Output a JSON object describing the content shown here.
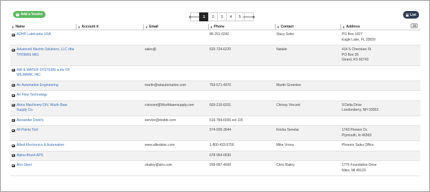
{
  "toolbar": {
    "add_vendor_label": "Add a Vendor",
    "list_label": "List",
    "pagination": {
      "prev": "🡐",
      "next": "🡒",
      "pages": [
        "1",
        "2",
        "3",
        "4",
        "5"
      ],
      "current": "1"
    }
  },
  "table": {
    "headers": {
      "name": "Name",
      "account": "Account #:",
      "email": "Email",
      "phone": "Phone",
      "contact": "Contact",
      "address": "Address"
    },
    "rows": [
      {
        "name": "ADHP Lubricants USA",
        "account": "",
        "email": "",
        "phone": "86-291-0240",
        "contact": "Stacy Soler",
        "address": [
          "PO Box 1427",
          "Eagle Lake, FL 33839"
        ]
      },
      {
        "name": "Advanced Machin Solutions, LLC dba THOMAS MIG",
        "account": "",
        "email": "sales@",
        "phone": "620-724-6220",
        "contact": "Natalie",
        "address": [
          "414 S Cherokee St",
          "PO Box 39",
          "Girard, KS 66743"
        ]
      },
      {
        "name": "AIR & WATER SYSTEMS a div OF WILMARK, INC",
        "account": "",
        "email": "",
        "phone": "",
        "contact": "",
        "address": []
      },
      {
        "name": "Air Automation Engineering",
        "account": "",
        "email": "martin@airautomation.com",
        "phone": "763-571-4970",
        "contact": "Martin Greenlee",
        "address": []
      },
      {
        "name": "Air Flow Technology",
        "account": "",
        "email": "",
        "phone": "",
        "contact": "",
        "address": []
      },
      {
        "name": "Akins Machinery DIV. Wurth Baer Supply Co.",
        "account": "",
        "email": "cvincent@Wurthbaersupply.com",
        "phone": "603-216-6201",
        "contact": "Chrissy Vincent",
        "address": [
          "9 Delta Drive",
          "Londonderry, NH 03053"
        ]
      },
      {
        "name": "Alexander Dodd's",
        "account": "",
        "email": "service@dodds.com",
        "phone": "616-784-6000 ext 115",
        "contact": "",
        "address": []
      },
      {
        "name": "All Points Tool",
        "account": "",
        "email": "",
        "phone": "574-935-3944",
        "contact": "Krisha Senetar",
        "address": [
          "1743 Pioneer Dr.",
          "Plymouth, In 46563"
        ]
      },
      {
        "name": "Allied Electronics & Automation",
        "account": "",
        "email": "www.alliedelec.com",
        "phone": "1-800-433-5700",
        "contact": "Mike Vrona",
        "address": [
          "Phoenix Sales Office"
        ]
      },
      {
        "name": "Alpha-Brush APS",
        "account": "",
        "email": "",
        "phone": "678-954-0530",
        "contact": "",
        "address": []
      },
      {
        "name": "Alro-Steel",
        "account": "",
        "email": "cbailey@alro.com",
        "phone": "269-687-4000",
        "contact": "Chris Bailey",
        "address": [
          "1775 Foundation Drive",
          "Niles, MI 49120"
        ]
      }
    ]
  },
  "colors": {
    "add_button": "#5cb85c",
    "list_button": "#2f3b52",
    "link": "#3a6db5",
    "active_page": "#222222"
  }
}
